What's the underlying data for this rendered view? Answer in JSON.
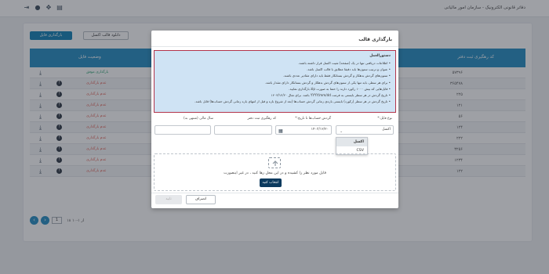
{
  "app": {
    "title": "دفاتر قانونی الکترونیک - سازمان امور مالیاتی"
  },
  "toolbar": {
    "upload_label": "بارگذاری فایل",
    "template_label": "دانلود قالب اکسل"
  },
  "table": {
    "headers": {
      "status": "وضعیت فایل",
      "tracking": "کد رهگیری ثبت دفتر"
    },
    "rows": [
      {
        "status": "بارگذاری موفق",
        "ok": true,
        "tracking": "۵۷۳۹۶"
      },
      {
        "status": "عدم بارگذاری",
        "ok": false,
        "tracking": "۳۶۵۴۷۸"
      },
      {
        "status": "عدم بارگذاری",
        "ok": false,
        "tracking": "۲۲۵"
      },
      {
        "status": "عدم بارگذاری",
        "ok": false,
        "tracking": "۱۲۱"
      },
      {
        "status": "عدم بارگذاری",
        "ok": false,
        "tracking": "۵۶"
      },
      {
        "status": "عدم بارگذاری",
        "ok": false,
        "tracking": "۱۲۴"
      },
      {
        "status": "عدم بارگذاری",
        "ok": false,
        "tracking": "۲۲۲"
      },
      {
        "status": "عدم بارگذاری",
        "ok": false,
        "tracking": "۳۲۵۶"
      },
      {
        "status": "عدم بارگذاری",
        "ok": false,
        "tracking": "۱۲۳۴"
      },
      {
        "status": "عدم بارگذاری",
        "ok": false,
        "tracking": "۱۲۲"
      }
    ]
  },
  "pager": {
    "page": "1",
    "info": "۱۸ از ۱-۱۰"
  },
  "modal": {
    "title": "بارگذاری قالب",
    "instructions_title": "دستورالعمل",
    "instructions": [
      "اطلاعات دریافتی تنها در یک (صفحه) شیت اکسل قرار داشته باشند.",
      "عنوان و ترتیب ستون‌ها باید دقیقا مطابق با قالب اکسل باشد.",
      "ستون‌های گردش بدهکار و گردش بستانکار فقط باید دارای مقادیر عددی باشند.",
      "برای هر سطر، باید تنها یکی از ستون‌های گردش بدهکار و گردش بستانکار دارای مقدار باشد.",
      "فایل‌هایی که بیش ۱۰۰۰ رکورد دارند را حتما به صورت zip بارگذاری نمایید.",
      "تاریخ گردش در هر سطر بایستی به فرمت YYYY/mm/dd باشد. برای مثال ۱۴۰۳/۱۲/۲۰",
      "تاریخ گردش در هر سطر (رکورد) بایستی بازه‌ی زمانی گردش حساب‌ها (بعد از شروع بازه و قبل از انتهای بازه زمانی گردش حساب‌ها) قابل باشد."
    ],
    "fields": {
      "file_type_label": "نوع فایل:*",
      "file_type_value": "اکسل",
      "date_label": "گردش حساب‌ها تا تاریخ:*",
      "date_value": "۱۴۰۳/۱۲/۲۰",
      "tracking_label": "کد رهگیری ثبت دفتر",
      "fiscal_label": "سال مالی (منتهی به)"
    },
    "dropdown_options": [
      "اکسل",
      "CSV"
    ],
    "dropzone_text": "فایل مورد نظر را کشیده و در این محل رها کنید ، در غیر اینصورت",
    "choose_label": "انتخاب کنید",
    "cancel_label": "انصراف",
    "confirm_label": "تایید"
  }
}
